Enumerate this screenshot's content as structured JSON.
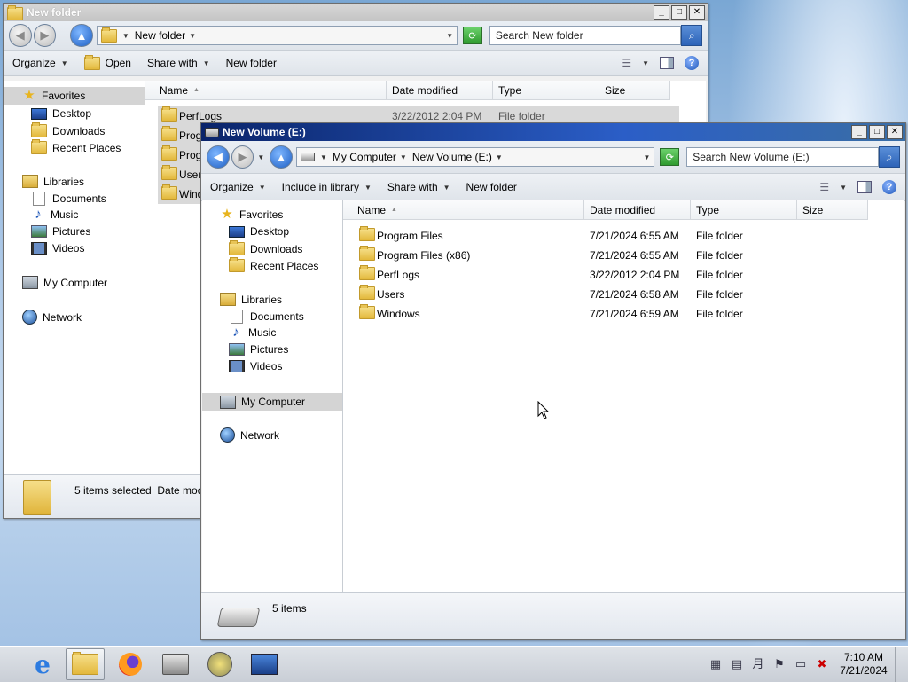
{
  "back_window": {
    "title": "New folder",
    "address_crumbs": [
      "New folder"
    ],
    "search_placeholder": "Search New folder",
    "commands": [
      "Organize",
      "Open",
      "Share with",
      "New folder"
    ],
    "nav": {
      "favorites": "Favorites",
      "desktop": "Desktop",
      "downloads": "Downloads",
      "recent": "Recent Places",
      "libraries": "Libraries",
      "documents": "Documents",
      "music": "Music",
      "pictures": "Pictures",
      "videos": "Videos",
      "computer": "My Computer",
      "network": "Network"
    },
    "columns": [
      "Name",
      "Date modified",
      "Type",
      "Size"
    ],
    "rows": [
      {
        "name": "PerfLogs",
        "date": "3/22/2012 2:04 PM",
        "type": "File folder"
      },
      {
        "name": "Progr",
        "date": "",
        "type": ""
      },
      {
        "name": "Progr",
        "date": "",
        "type": ""
      },
      {
        "name": "Users",
        "date": "",
        "type": ""
      },
      {
        "name": "Windo",
        "date": "",
        "type": ""
      }
    ],
    "status": "5 items selected  Date mod"
  },
  "front_window": {
    "title": "New Volume (E:)",
    "address_crumbs": [
      "My Computer",
      "New Volume (E:)"
    ],
    "search_placeholder": "Search New Volume (E:)",
    "commands": [
      "Organize",
      "Include in library",
      "Share with",
      "New folder"
    ],
    "nav": {
      "favorites": "Favorites",
      "desktop": "Desktop",
      "downloads": "Downloads",
      "recent": "Recent Places",
      "libraries": "Libraries",
      "documents": "Documents",
      "music": "Music",
      "pictures": "Pictures",
      "videos": "Videos",
      "computer": "My Computer",
      "network": "Network"
    },
    "columns": [
      "Name",
      "Date modified",
      "Type",
      "Size"
    ],
    "rows": [
      {
        "name": "Program Files",
        "date": "7/21/2024 6:55 AM",
        "type": "File folder"
      },
      {
        "name": "Program Files (x86)",
        "date": "7/21/2024 6:55 AM",
        "type": "File folder"
      },
      {
        "name": "PerfLogs",
        "date": "3/22/2012 2:04 PM",
        "type": "File folder"
      },
      {
        "name": "Users",
        "date": "7/21/2024 6:58 AM",
        "type": "File folder"
      },
      {
        "name": "Windows",
        "date": "7/21/2024 6:59 AM",
        "type": "File folder"
      }
    ],
    "status": "5 items"
  },
  "taskbar": {
    "clock_time": "7:10 AM",
    "clock_date": "7/21/2024"
  }
}
